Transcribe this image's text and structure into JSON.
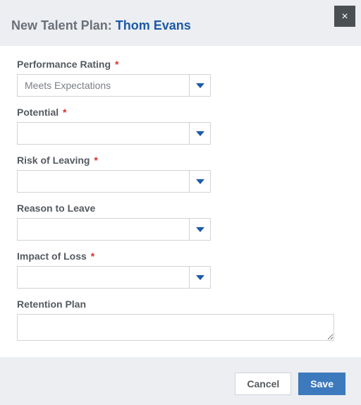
{
  "header": {
    "title_prefix": "New Talent Plan: ",
    "employee_name": "Thom Evans",
    "close_glyph": "×"
  },
  "fields": {
    "performance": {
      "label": "Performance Rating",
      "required": "*",
      "value": "Meets Expectations"
    },
    "potential": {
      "label": "Potential",
      "required": "*",
      "value": ""
    },
    "risk": {
      "label": "Risk of Leaving",
      "required": "*",
      "value": ""
    },
    "reason": {
      "label": "Reason to Leave",
      "required": "",
      "value": ""
    },
    "impact": {
      "label": "Impact of Loss",
      "required": "*",
      "value": ""
    },
    "retention": {
      "label": "Retention Plan",
      "value": ""
    }
  },
  "footer": {
    "cancel_label": "Cancel",
    "save_label": "Save"
  }
}
